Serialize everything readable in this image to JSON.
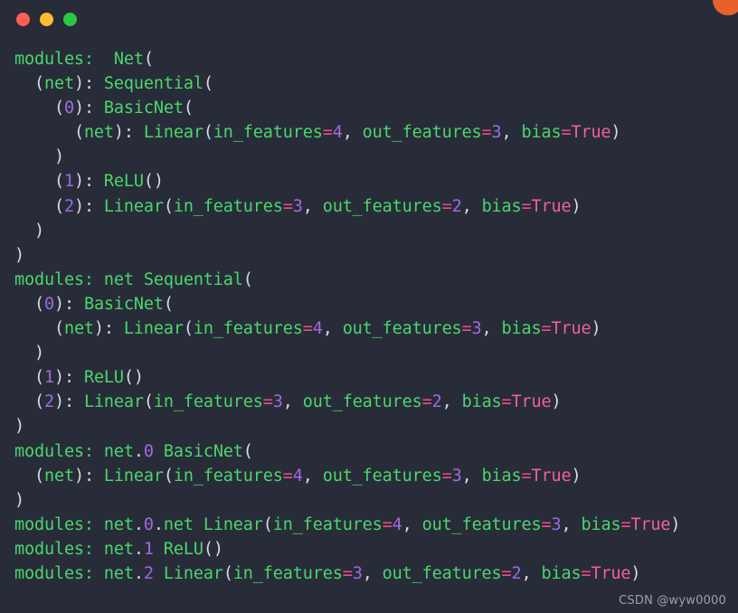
{
  "window": {
    "title_bar": {
      "dots": [
        {
          "name": "close-dot",
          "color": "#ff5f57"
        },
        {
          "name": "minimize-dot",
          "color": "#febc2e"
        },
        {
          "name": "maximize-dot",
          "color": "#28c840"
        }
      ],
      "corner_badge_color": "#e8602c"
    },
    "background_color": "#282c38"
  },
  "theme": {
    "identifier": "#4ad66d",
    "punctuation": "#d8dce6",
    "number": "#a06ae0",
    "operator": "#ef4b8a",
    "boolean": "#f0609a"
  },
  "watermark": "CSDN @wyw0000",
  "terminal": {
    "lines": [
      [
        {
          "t": "modules:  ",
          "c": "t-name"
        },
        {
          "t": "Net",
          "c": "t-name"
        },
        {
          "t": "(",
          "c": "t-punc"
        }
      ],
      [
        {
          "t": "  ",
          "c": "t-plain"
        },
        {
          "t": "(",
          "c": "t-punc"
        },
        {
          "t": "net",
          "c": "t-name"
        },
        {
          "t": "): ",
          "c": "t-punc"
        },
        {
          "t": "Sequential",
          "c": "t-name"
        },
        {
          "t": "(",
          "c": "t-punc"
        }
      ],
      [
        {
          "t": "    ",
          "c": "t-plain"
        },
        {
          "t": "(",
          "c": "t-punc"
        },
        {
          "t": "0",
          "c": "t-num"
        },
        {
          "t": "): ",
          "c": "t-punc"
        },
        {
          "t": "BasicNet",
          "c": "t-name"
        },
        {
          "t": "(",
          "c": "t-punc"
        }
      ],
      [
        {
          "t": "      ",
          "c": "t-plain"
        },
        {
          "t": "(",
          "c": "t-punc"
        },
        {
          "t": "net",
          "c": "t-name"
        },
        {
          "t": "): ",
          "c": "t-punc"
        },
        {
          "t": "Linear",
          "c": "t-name"
        },
        {
          "t": "(",
          "c": "t-punc"
        },
        {
          "t": "in_features",
          "c": "t-name"
        },
        {
          "t": "=",
          "c": "t-op"
        },
        {
          "t": "4",
          "c": "t-num"
        },
        {
          "t": ", ",
          "c": "t-punc"
        },
        {
          "t": "out_features",
          "c": "t-name"
        },
        {
          "t": "=",
          "c": "t-op"
        },
        {
          "t": "3",
          "c": "t-num"
        },
        {
          "t": ", ",
          "c": "t-punc"
        },
        {
          "t": "bias",
          "c": "t-name"
        },
        {
          "t": "=",
          "c": "t-op"
        },
        {
          "t": "True",
          "c": "t-bool"
        },
        {
          "t": ")",
          "c": "t-punc"
        }
      ],
      [
        {
          "t": "    ",
          "c": "t-plain"
        },
        {
          "t": ")",
          "c": "t-punc"
        }
      ],
      [
        {
          "t": "    ",
          "c": "t-plain"
        },
        {
          "t": "(",
          "c": "t-punc"
        },
        {
          "t": "1",
          "c": "t-num"
        },
        {
          "t": "): ",
          "c": "t-punc"
        },
        {
          "t": "ReLU",
          "c": "t-name"
        },
        {
          "t": "()",
          "c": "t-punc"
        }
      ],
      [
        {
          "t": "    ",
          "c": "t-plain"
        },
        {
          "t": "(",
          "c": "t-punc"
        },
        {
          "t": "2",
          "c": "t-num"
        },
        {
          "t": "): ",
          "c": "t-punc"
        },
        {
          "t": "Linear",
          "c": "t-name"
        },
        {
          "t": "(",
          "c": "t-punc"
        },
        {
          "t": "in_features",
          "c": "t-name"
        },
        {
          "t": "=",
          "c": "t-op"
        },
        {
          "t": "3",
          "c": "t-num"
        },
        {
          "t": ", ",
          "c": "t-punc"
        },
        {
          "t": "out_features",
          "c": "t-name"
        },
        {
          "t": "=",
          "c": "t-op"
        },
        {
          "t": "2",
          "c": "t-num"
        },
        {
          "t": ", ",
          "c": "t-punc"
        },
        {
          "t": "bias",
          "c": "t-name"
        },
        {
          "t": "=",
          "c": "t-op"
        },
        {
          "t": "True",
          "c": "t-bool"
        },
        {
          "t": ")",
          "c": "t-punc"
        }
      ],
      [
        {
          "t": "  ",
          "c": "t-plain"
        },
        {
          "t": ")",
          "c": "t-punc"
        }
      ],
      [
        {
          "t": ")",
          "c": "t-punc"
        }
      ],
      [
        {
          "t": "modules: ",
          "c": "t-name"
        },
        {
          "t": "net",
          "c": "t-name"
        },
        {
          "t": " ",
          "c": "t-plain"
        },
        {
          "t": "Sequential",
          "c": "t-name"
        },
        {
          "t": "(",
          "c": "t-punc"
        }
      ],
      [
        {
          "t": "  ",
          "c": "t-plain"
        },
        {
          "t": "(",
          "c": "t-punc"
        },
        {
          "t": "0",
          "c": "t-num"
        },
        {
          "t": "): ",
          "c": "t-punc"
        },
        {
          "t": "BasicNet",
          "c": "t-name"
        },
        {
          "t": "(",
          "c": "t-punc"
        }
      ],
      [
        {
          "t": "    ",
          "c": "t-plain"
        },
        {
          "t": "(",
          "c": "t-punc"
        },
        {
          "t": "net",
          "c": "t-name"
        },
        {
          "t": "): ",
          "c": "t-punc"
        },
        {
          "t": "Linear",
          "c": "t-name"
        },
        {
          "t": "(",
          "c": "t-punc"
        },
        {
          "t": "in_features",
          "c": "t-name"
        },
        {
          "t": "=",
          "c": "t-op"
        },
        {
          "t": "4",
          "c": "t-num"
        },
        {
          "t": ", ",
          "c": "t-punc"
        },
        {
          "t": "out_features",
          "c": "t-name"
        },
        {
          "t": "=",
          "c": "t-op"
        },
        {
          "t": "3",
          "c": "t-num"
        },
        {
          "t": ", ",
          "c": "t-punc"
        },
        {
          "t": "bias",
          "c": "t-name"
        },
        {
          "t": "=",
          "c": "t-op"
        },
        {
          "t": "True",
          "c": "t-bool"
        },
        {
          "t": ")",
          "c": "t-punc"
        }
      ],
      [
        {
          "t": "  ",
          "c": "t-plain"
        },
        {
          "t": ")",
          "c": "t-punc"
        }
      ],
      [
        {
          "t": "  ",
          "c": "t-plain"
        },
        {
          "t": "(",
          "c": "t-punc"
        },
        {
          "t": "1",
          "c": "t-num"
        },
        {
          "t": "): ",
          "c": "t-punc"
        },
        {
          "t": "ReLU",
          "c": "t-name"
        },
        {
          "t": "()",
          "c": "t-punc"
        }
      ],
      [
        {
          "t": "  ",
          "c": "t-plain"
        },
        {
          "t": "(",
          "c": "t-punc"
        },
        {
          "t": "2",
          "c": "t-num"
        },
        {
          "t": "): ",
          "c": "t-punc"
        },
        {
          "t": "Linear",
          "c": "t-name"
        },
        {
          "t": "(",
          "c": "t-punc"
        },
        {
          "t": "in_features",
          "c": "t-name"
        },
        {
          "t": "=",
          "c": "t-op"
        },
        {
          "t": "3",
          "c": "t-num"
        },
        {
          "t": ", ",
          "c": "t-punc"
        },
        {
          "t": "out_features",
          "c": "t-name"
        },
        {
          "t": "=",
          "c": "t-op"
        },
        {
          "t": "2",
          "c": "t-num"
        },
        {
          "t": ", ",
          "c": "t-punc"
        },
        {
          "t": "bias",
          "c": "t-name"
        },
        {
          "t": "=",
          "c": "t-op"
        },
        {
          "t": "True",
          "c": "t-bool"
        },
        {
          "t": ")",
          "c": "t-punc"
        }
      ],
      [
        {
          "t": ")",
          "c": "t-punc"
        }
      ],
      [
        {
          "t": "modules: ",
          "c": "t-name"
        },
        {
          "t": "net",
          "c": "t-name"
        },
        {
          "t": ".",
          "c": "t-punc"
        },
        {
          "t": "0",
          "c": "t-num"
        },
        {
          "t": " ",
          "c": "t-plain"
        },
        {
          "t": "BasicNet",
          "c": "t-name"
        },
        {
          "t": "(",
          "c": "t-punc"
        }
      ],
      [
        {
          "t": "  ",
          "c": "t-plain"
        },
        {
          "t": "(",
          "c": "t-punc"
        },
        {
          "t": "net",
          "c": "t-name"
        },
        {
          "t": "): ",
          "c": "t-punc"
        },
        {
          "t": "Linear",
          "c": "t-name"
        },
        {
          "t": "(",
          "c": "t-punc"
        },
        {
          "t": "in_features",
          "c": "t-name"
        },
        {
          "t": "=",
          "c": "t-op"
        },
        {
          "t": "4",
          "c": "t-num"
        },
        {
          "t": ", ",
          "c": "t-punc"
        },
        {
          "t": "out_features",
          "c": "t-name"
        },
        {
          "t": "=",
          "c": "t-op"
        },
        {
          "t": "3",
          "c": "t-num"
        },
        {
          "t": ", ",
          "c": "t-punc"
        },
        {
          "t": "bias",
          "c": "t-name"
        },
        {
          "t": "=",
          "c": "t-op"
        },
        {
          "t": "True",
          "c": "t-bool"
        },
        {
          "t": ")",
          "c": "t-punc"
        }
      ],
      [
        {
          "t": ")",
          "c": "t-punc"
        }
      ],
      [
        {
          "t": "modules: ",
          "c": "t-name"
        },
        {
          "t": "net",
          "c": "t-name"
        },
        {
          "t": ".",
          "c": "t-punc"
        },
        {
          "t": "0",
          "c": "t-num"
        },
        {
          "t": ".",
          "c": "t-punc"
        },
        {
          "t": "net",
          "c": "t-name"
        },
        {
          "t": " ",
          "c": "t-plain"
        },
        {
          "t": "Linear",
          "c": "t-name"
        },
        {
          "t": "(",
          "c": "t-punc"
        },
        {
          "t": "in_features",
          "c": "t-name"
        },
        {
          "t": "=",
          "c": "t-op"
        },
        {
          "t": "4",
          "c": "t-num"
        },
        {
          "t": ", ",
          "c": "t-punc"
        },
        {
          "t": "out_features",
          "c": "t-name"
        },
        {
          "t": "=",
          "c": "t-op"
        },
        {
          "t": "3",
          "c": "t-num"
        },
        {
          "t": ", ",
          "c": "t-punc"
        },
        {
          "t": "bias",
          "c": "t-name"
        },
        {
          "t": "=",
          "c": "t-op"
        },
        {
          "t": "True",
          "c": "t-bool"
        },
        {
          "t": ")",
          "c": "t-punc"
        }
      ],
      [
        {
          "t": "modules: ",
          "c": "t-name"
        },
        {
          "t": "net",
          "c": "t-name"
        },
        {
          "t": ".",
          "c": "t-punc"
        },
        {
          "t": "1",
          "c": "t-num"
        },
        {
          "t": " ",
          "c": "t-plain"
        },
        {
          "t": "ReLU",
          "c": "t-name"
        },
        {
          "t": "()",
          "c": "t-punc"
        }
      ],
      [
        {
          "t": "modules: ",
          "c": "t-name"
        },
        {
          "t": "net",
          "c": "t-name"
        },
        {
          "t": ".",
          "c": "t-punc"
        },
        {
          "t": "2",
          "c": "t-num"
        },
        {
          "t": " ",
          "c": "t-plain"
        },
        {
          "t": "Linear",
          "c": "t-name"
        },
        {
          "t": "(",
          "c": "t-punc"
        },
        {
          "t": "in_features",
          "c": "t-name"
        },
        {
          "t": "=",
          "c": "t-op"
        },
        {
          "t": "3",
          "c": "t-num"
        },
        {
          "t": ", ",
          "c": "t-punc"
        },
        {
          "t": "out_features",
          "c": "t-name"
        },
        {
          "t": "=",
          "c": "t-op"
        },
        {
          "t": "2",
          "c": "t-num"
        },
        {
          "t": ", ",
          "c": "t-punc"
        },
        {
          "t": "bias",
          "c": "t-name"
        },
        {
          "t": "=",
          "c": "t-op"
        },
        {
          "t": "True",
          "c": "t-bool"
        },
        {
          "t": ")",
          "c": "t-punc"
        }
      ]
    ]
  }
}
